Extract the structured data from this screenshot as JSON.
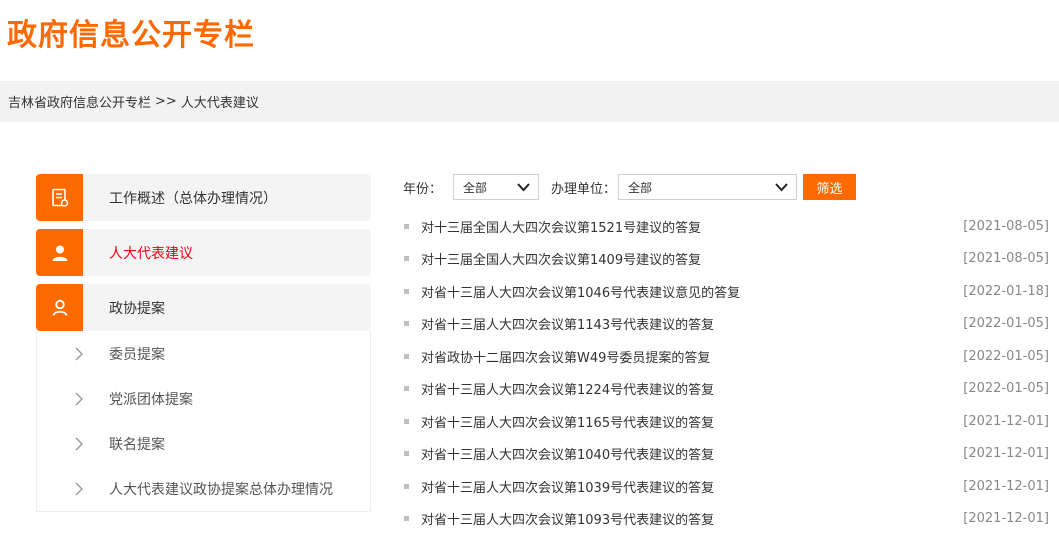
{
  "header": {
    "title": "政府信息公开专栏"
  },
  "breadcrumb": {
    "root": "吉林省政府信息公开专栏",
    "separator": ">>",
    "current": "人大代表建议"
  },
  "sidebar": {
    "items": [
      {
        "label": "工作概述（总体办理情况）",
        "icon": "document-icon",
        "active": false
      },
      {
        "label": "人大代表建议",
        "icon": "person-icon",
        "active": true
      },
      {
        "label": "政协提案",
        "icon": "user-outline-icon",
        "active": false
      }
    ],
    "sub_items": [
      {
        "label": "委员提案"
      },
      {
        "label": "党派团体提案"
      },
      {
        "label": "联名提案"
      },
      {
        "label": "人大代表建议政协提案总体办理情况"
      }
    ]
  },
  "filter": {
    "year_label": "年份：",
    "year_value": "全部",
    "unit_label": "办理单位：",
    "unit_value": "全部",
    "button_label": "筛选"
  },
  "list": [
    {
      "title": "对十三届全国人大四次会议第1521号建议的答复",
      "date": "[2021-08-05]"
    },
    {
      "title": "对十三届全国人大四次会议第1409号建议的答复",
      "date": "[2021-08-05]"
    },
    {
      "title": "对省十三届人大四次会议第1046号代表建议意见的答复",
      "date": "[2022-01-18]"
    },
    {
      "title": "对省十三届人大四次会议第1143号代表建议的答复",
      "date": "[2022-01-05]"
    },
    {
      "title": "对省政协十二届四次会议第W49号委员提案的答复",
      "date": "[2022-01-05]"
    },
    {
      "title": "对省十三届人大四次会议第1224号代表建议的答复",
      "date": "[2022-01-05]"
    },
    {
      "title": "对省十三届人大四次会议第1165号代表建议的答复",
      "date": "[2021-12-01]"
    },
    {
      "title": "对省十三届人大四次会议第1040号代表建议的答复",
      "date": "[2021-12-01]"
    },
    {
      "title": "对省十三届人大四次会议第1039号代表建议的答复",
      "date": "[2021-12-01]"
    },
    {
      "title": "对省十三届人大四次会议第1093号代表建议的答复",
      "date": "[2021-12-01]"
    }
  ],
  "colors": {
    "accent": "#ff6a00",
    "active_text": "#e60012"
  }
}
